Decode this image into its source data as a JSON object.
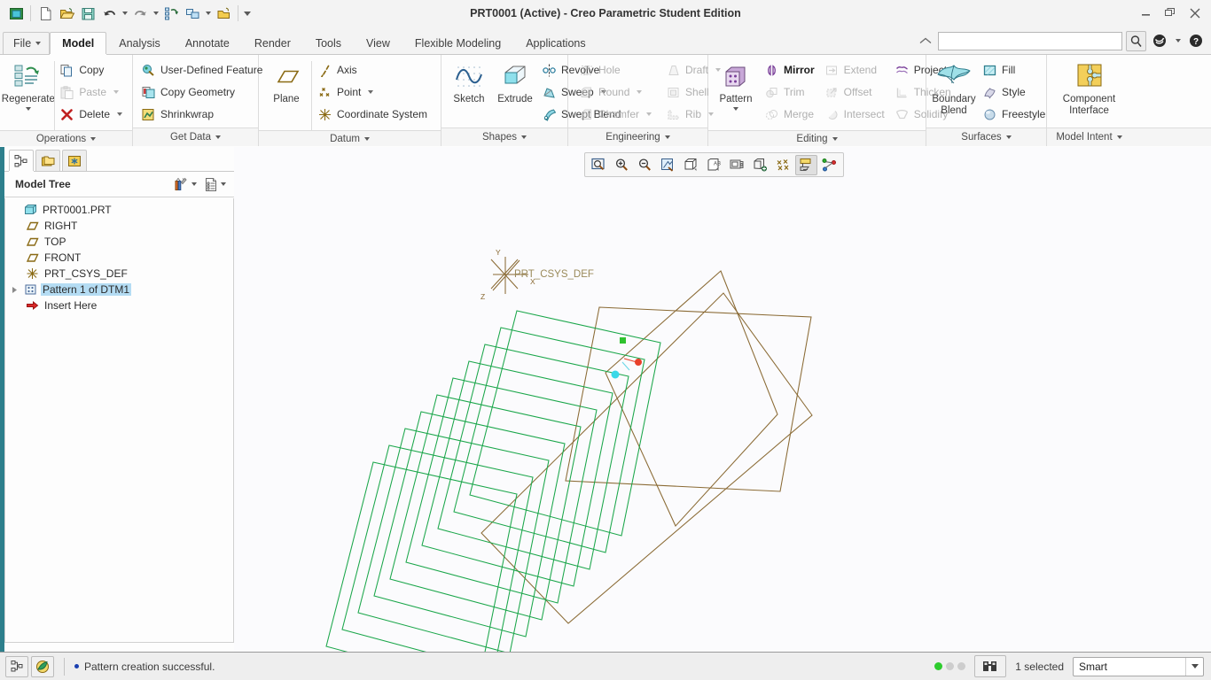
{
  "window": {
    "title": "PRT0001 (Active) - Creo Parametric Student Edition",
    "minimize": "—",
    "restore": "❐",
    "close": "✕"
  },
  "quick_access": {
    "items": [
      {
        "name": "new-window-icon",
        "tip": "New Window"
      },
      {
        "name": "new-file-icon",
        "tip": "New"
      },
      {
        "name": "open-file-icon",
        "tip": "Open"
      },
      {
        "name": "save-icon",
        "tip": "Save"
      },
      {
        "name": "undo-icon",
        "tip": "Undo"
      },
      {
        "name": "redo-icon",
        "tip": "Redo"
      },
      {
        "name": "regenerate-icon",
        "tip": "Regenerate"
      },
      {
        "name": "window-switch-icon",
        "tip": "Switch Window"
      },
      {
        "name": "close-window-icon",
        "tip": "Close"
      }
    ],
    "customize_tip": "Customize Quick Access Toolbar"
  },
  "tabs": {
    "file_label": "File",
    "items": [
      {
        "label": "Model",
        "active": true
      },
      {
        "label": "Analysis",
        "active": false
      },
      {
        "label": "Annotate",
        "active": false
      },
      {
        "label": "Render",
        "active": false
      },
      {
        "label": "Tools",
        "active": false
      },
      {
        "label": "View",
        "active": false
      },
      {
        "label": "Flexible Modeling",
        "active": false
      },
      {
        "label": "Applications",
        "active": false
      }
    ]
  },
  "search": {
    "value": "",
    "placeholder": "",
    "search_tip": "Search",
    "help_tip": "Help",
    "collapse_tip": "Minimize the Ribbon"
  },
  "ribbon": {
    "groups": [
      {
        "label": "Operations",
        "big": [
          {
            "label1": "Regenerate",
            "label2": "",
            "icon": "regenerate-icon",
            "has_menu": true,
            "disabled": false
          }
        ],
        "columns": [
          [
            {
              "label": "Copy",
              "icon": "copy-icon",
              "disabled": false,
              "menu": false
            },
            {
              "label": "Paste",
              "icon": "paste-icon",
              "disabled": true,
              "menu": true
            },
            {
              "label": "Delete",
              "icon": "delete-icon",
              "disabled": false,
              "menu": true
            }
          ]
        ]
      },
      {
        "label": "Get Data",
        "big": [],
        "columns": [
          [
            {
              "label": "User-Defined Feature",
              "icon": "udf-icon",
              "disabled": false,
              "menu": false
            },
            {
              "label": "Copy Geometry",
              "icon": "copy-geometry-icon",
              "disabled": false,
              "menu": false
            },
            {
              "label": "Shrinkwrap",
              "icon": "shrinkwrap-icon",
              "disabled": false,
              "menu": false
            }
          ]
        ]
      },
      {
        "label": "Datum",
        "big": [
          {
            "label1": "Plane",
            "label2": "",
            "icon": "plane-icon",
            "has_menu": false,
            "disabled": false
          }
        ],
        "columns": [
          [
            {
              "label": "Axis",
              "icon": "axis-icon",
              "disabled": false,
              "menu": false
            },
            {
              "label": "Point",
              "icon": "point-icon",
              "disabled": false,
              "menu": true
            },
            {
              "label": "Coordinate System",
              "icon": "coordinate-system-icon",
              "disabled": false,
              "menu": false
            }
          ]
        ]
      },
      {
        "label": "Shapes",
        "big": [
          {
            "label1": "Sketch",
            "label2": "",
            "icon": "sketch-icon",
            "has_menu": false,
            "disabled": false
          },
          {
            "label1": "Extrude",
            "label2": "",
            "icon": "extrude-icon",
            "has_menu": false,
            "disabled": false
          }
        ],
        "columns": [
          [
            {
              "label": "Revolve",
              "icon": "revolve-icon",
              "disabled": false,
              "menu": false
            },
            {
              "label": "Sweep",
              "icon": "sweep-icon",
              "disabled": false,
              "menu": true
            },
            {
              "label": "Swept Blend",
              "icon": "swept-blend-icon",
              "disabled": false,
              "menu": false
            }
          ]
        ]
      },
      {
        "label": "Engineering",
        "big": [],
        "columns": [
          [
            {
              "label": "Hole",
              "icon": "hole-icon",
              "disabled": true,
              "menu": false
            },
            {
              "label": "Round",
              "icon": "round-icon",
              "disabled": true,
              "menu": true
            },
            {
              "label": "Chamfer",
              "icon": "chamfer-icon",
              "disabled": true,
              "menu": true
            }
          ],
          [
            {
              "label": "Draft",
              "icon": "draft-icon",
              "disabled": true,
              "menu": true
            },
            {
              "label": "Shell",
              "icon": "shell-icon",
              "disabled": true,
              "menu": false
            },
            {
              "label": "Rib",
              "icon": "rib-icon",
              "disabled": true,
              "menu": true
            }
          ]
        ]
      },
      {
        "label": "Editing",
        "big": [
          {
            "label1": "Pattern",
            "label2": "",
            "icon": "pattern-icon",
            "has_menu": true,
            "disabled": false
          }
        ],
        "columns": [
          [
            {
              "label": "Mirror",
              "icon": "mirror-icon",
              "disabled": false,
              "menu": false
            },
            {
              "label": "Trim",
              "icon": "trim-icon",
              "disabled": true,
              "menu": false
            },
            {
              "label": "Merge",
              "icon": "merge-icon",
              "disabled": true,
              "menu": false
            }
          ],
          [
            {
              "label": "Extend",
              "icon": "extend-icon",
              "disabled": true,
              "menu": false
            },
            {
              "label": "Offset",
              "icon": "offset-icon",
              "disabled": true,
              "menu": false
            },
            {
              "label": "Intersect",
              "icon": "intersect-icon",
              "disabled": true,
              "menu": false
            }
          ],
          [
            {
              "label": "Project",
              "icon": "project-icon",
              "disabled": false,
              "menu": false
            },
            {
              "label": "Thicken",
              "icon": "thicken-icon",
              "disabled": true,
              "menu": false
            },
            {
              "label": "Solidify",
              "icon": "solidify-icon",
              "disabled": true,
              "menu": false
            }
          ]
        ]
      },
      {
        "label": "Surfaces",
        "big": [
          {
            "label1": "Boundary",
            "label2": "Blend",
            "icon": "boundary-blend-icon",
            "has_menu": false,
            "disabled": false
          }
        ],
        "columns": [
          [
            {
              "label": "Fill",
              "icon": "fill-icon",
              "disabled": false,
              "menu": false
            },
            {
              "label": "Style",
              "icon": "style-icon",
              "disabled": false,
              "menu": false
            },
            {
              "label": "Freestyle",
              "icon": "freestyle-icon",
              "disabled": false,
              "menu": false
            }
          ]
        ]
      },
      {
        "label": "Model Intent",
        "big": [
          {
            "label1": "Component",
            "label2": "Interface",
            "icon": "component-interface-icon",
            "has_menu": false,
            "disabled": false
          }
        ],
        "columns": []
      }
    ]
  },
  "left_panel": {
    "nav_tabs": [
      {
        "name": "model-tree-tab",
        "active": true
      },
      {
        "name": "folder-browser-tab",
        "active": false
      },
      {
        "name": "favorites-tab",
        "active": false
      }
    ],
    "tree_title": "Model Tree",
    "tools": [
      {
        "name": "tree-filters-icon",
        "has_menu": true
      },
      {
        "name": "tree-settings-icon",
        "has_menu": true
      }
    ],
    "tree_items": [
      {
        "label": "PRT0001.PRT",
        "indent": 0,
        "icon": "part-icon",
        "expander": "none",
        "selected": false
      },
      {
        "label": "RIGHT",
        "indent": 1,
        "icon": "datum-plane-icon",
        "expander": "none",
        "selected": false
      },
      {
        "label": "TOP",
        "indent": 1,
        "icon": "datum-plane-icon",
        "expander": "none",
        "selected": false
      },
      {
        "label": "FRONT",
        "indent": 1,
        "icon": "datum-plane-icon",
        "expander": "none",
        "selected": false
      },
      {
        "label": "PRT_CSYS_DEF",
        "indent": 1,
        "icon": "csys-icon",
        "expander": "none",
        "selected": false
      },
      {
        "label": "Pattern 1 of DTM1",
        "indent": 1,
        "icon": "pattern-feature-icon",
        "expander": "collapsed",
        "selected": true
      },
      {
        "label": "Insert Here",
        "indent": 1,
        "icon": "insert-here-icon",
        "expander": "none",
        "selected": false
      }
    ]
  },
  "graphics_toolbar": {
    "buttons": [
      {
        "name": "refit-icon",
        "active": false
      },
      {
        "name": "zoom-in-icon",
        "active": false
      },
      {
        "name": "zoom-out-icon",
        "active": false
      },
      {
        "name": "repaint-icon",
        "active": false
      },
      {
        "name": "display-style-icon",
        "active": false
      },
      {
        "name": "saved-orientations-icon",
        "active": false
      },
      {
        "name": "view-manager-icon",
        "active": false
      },
      {
        "name": "perspective-view-icon",
        "active": false
      },
      {
        "name": "datum-display-filters-icon",
        "active": false
      },
      {
        "name": "annotation-display-icon",
        "active": true
      },
      {
        "name": "spin-center-icon",
        "active": false
      }
    ]
  },
  "viewport": {
    "csys_label": "PRT_CSYS_DEF",
    "axis_x": "X",
    "axis_y": "Y",
    "axis_z": "Z",
    "colors": {
      "selected_green": "#1aa64a",
      "datum_brown": "#8a6a34",
      "handle_green": "#2fc22f",
      "handle_red": "#e8402a",
      "handle_cyan": "#3ad8e8",
      "background": "#fbfbfd"
    },
    "pattern_instances": 10
  },
  "status_bar": {
    "message": "Pattern creation successful.",
    "selection_count": "1 selected",
    "filter_value": "Smart",
    "buttons": [
      {
        "name": "model-tree-toggle-icon"
      },
      {
        "name": "browser-toggle-icon"
      },
      {
        "name": "search-entities-icon"
      }
    ]
  }
}
